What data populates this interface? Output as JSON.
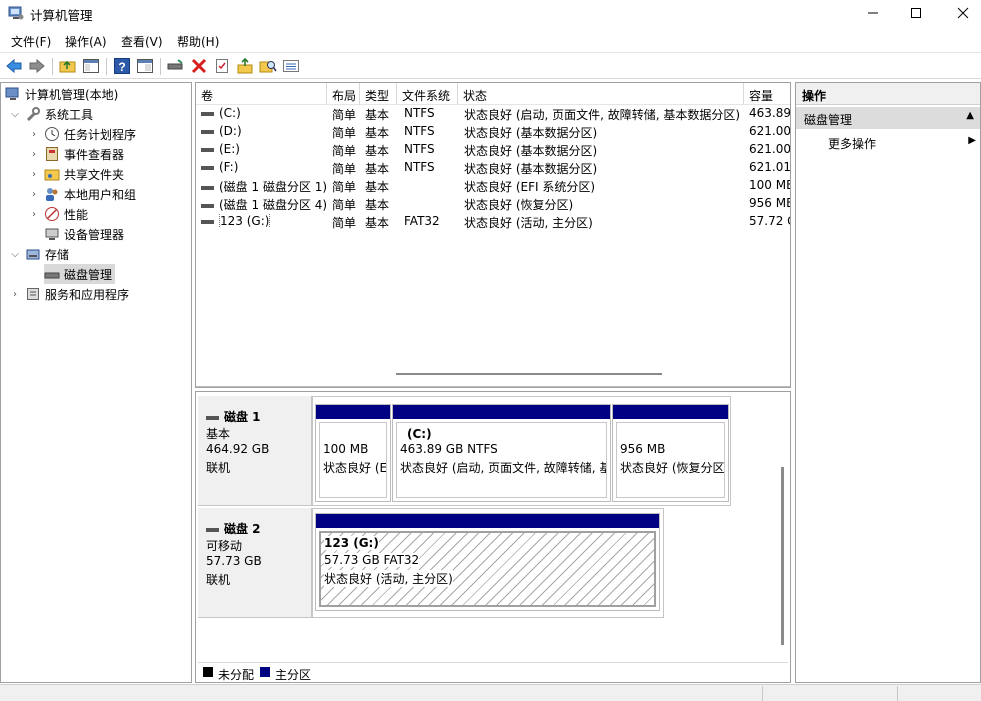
{
  "window": {
    "title": "计算机管理"
  },
  "menu": {
    "items": [
      "文件(F)",
      "操作(A)",
      "查看(V)",
      "帮助(H)"
    ]
  },
  "tree": {
    "root": "计算机管理(本地)",
    "system_tools": "系统工具",
    "task_scheduler": "任务计划程序",
    "event_viewer": "事件查看器",
    "shared_folders": "共享文件夹",
    "local_users": "本地用户和组",
    "performance": "性能",
    "device_manager": "设备管理器",
    "storage": "存储",
    "disk_management": "磁盘管理",
    "services_apps": "服务和应用程序"
  },
  "volumes": {
    "headers": [
      "卷",
      "布局",
      "类型",
      "文件系统",
      "状态",
      "容量"
    ],
    "rows": [
      [
        "(C:)",
        "简单",
        "基本",
        "NTFS",
        "状态良好 (启动, 页面文件, 故障转储, 基本数据分区)",
        "463.89"
      ],
      [
        "(D:)",
        "简单",
        "基本",
        "NTFS",
        "状态良好 (基本数据分区)",
        "621.00"
      ],
      [
        "(E:)",
        "简单",
        "基本",
        "NTFS",
        "状态良好 (基本数据分区)",
        "621.00"
      ],
      [
        "(F:)",
        "简单",
        "基本",
        "NTFS",
        "状态良好 (基本数据分区)",
        "621.01"
      ],
      [
        "(磁盘 1 磁盘分区 1)",
        "简单",
        "基本",
        "",
        "状态良好 (EFI 系统分区)",
        "100 ME"
      ],
      [
        "(磁盘 1 磁盘分区 4)",
        "简单",
        "基本",
        "",
        "状态良好 (恢复分区)",
        "956 ME"
      ],
      [
        "123 (G:)",
        "简单",
        "基本",
        "FAT32",
        "状态良好 (活动, 主分区)",
        "57.72 G"
      ]
    ]
  },
  "disk1": {
    "name": "磁盘 1",
    "type": "基本",
    "size": "464.92 GB",
    "status": "联机",
    "p1": {
      "size": "100 MB",
      "status": "状态良好 (E"
    },
    "p2": {
      "label": "(C:)",
      "size": "463.89 GB NTFS",
      "status": "状态良好 (启动, 页面文件, 故障转储, 基"
    },
    "p3": {
      "size": "956 MB",
      "status": "状态良好 (恢复分区"
    }
  },
  "disk2": {
    "name": "磁盘 2",
    "type": "可移动",
    "size": "57.73 GB",
    "status": "联机",
    "p1": {
      "label": "123  (G:)",
      "size": "57.73 GB FAT32",
      "status": "状态良好 (活动, 主分区)"
    }
  },
  "legend": {
    "unallocated": "未分配",
    "primary": "主分区"
  },
  "actions": {
    "header": "操作",
    "section": "磁盘管理",
    "more": "更多操作"
  },
  "colors": {
    "primary_partition": "#000082",
    "unallocated": "#000000",
    "selection": "#d9d9d9"
  }
}
